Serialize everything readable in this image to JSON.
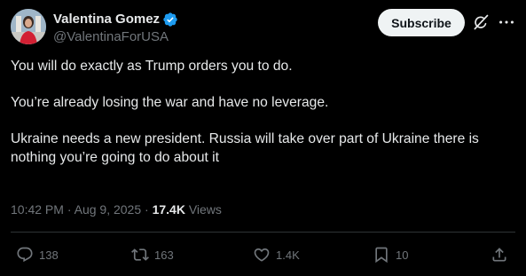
{
  "colors": {
    "background": "#000000",
    "text_primary": "#e7e9ea",
    "text_secondary": "#71767b",
    "verified_blue": "#1d9bf0",
    "subscribe_bg": "#eff3f4",
    "divider": "#2f3336"
  },
  "author": {
    "display_name": "Valentina Gomez",
    "handle": "@ValentinaForUSA",
    "verified_icon": "verified-badge-icon",
    "avatar_icon": "avatar"
  },
  "header": {
    "subscribe_label": "Subscribe",
    "grok_icon": "grok-icon",
    "more_icon": "more-icon"
  },
  "tweet": {
    "paragraphs": [
      "You will do exactly as Trump orders you to do.",
      "You’re already losing the war and have no leverage.",
      "Ukraine needs a new president. Russia will take over part of Ukraine there is nothing you’re going to do about it"
    ]
  },
  "meta": {
    "time": "10:42 PM",
    "separator": " · ",
    "date": "Aug 9, 2025",
    "views_count": "17.4K",
    "views_label": "Views"
  },
  "actions": {
    "reply": {
      "icon": "reply-icon",
      "count": "138"
    },
    "repost": {
      "icon": "repost-icon",
      "count": "163"
    },
    "like": {
      "icon": "heart-icon",
      "count": "1.4K"
    },
    "bookmark": {
      "icon": "bookmark-icon",
      "count": "10"
    },
    "share": {
      "icon": "share-icon"
    }
  }
}
